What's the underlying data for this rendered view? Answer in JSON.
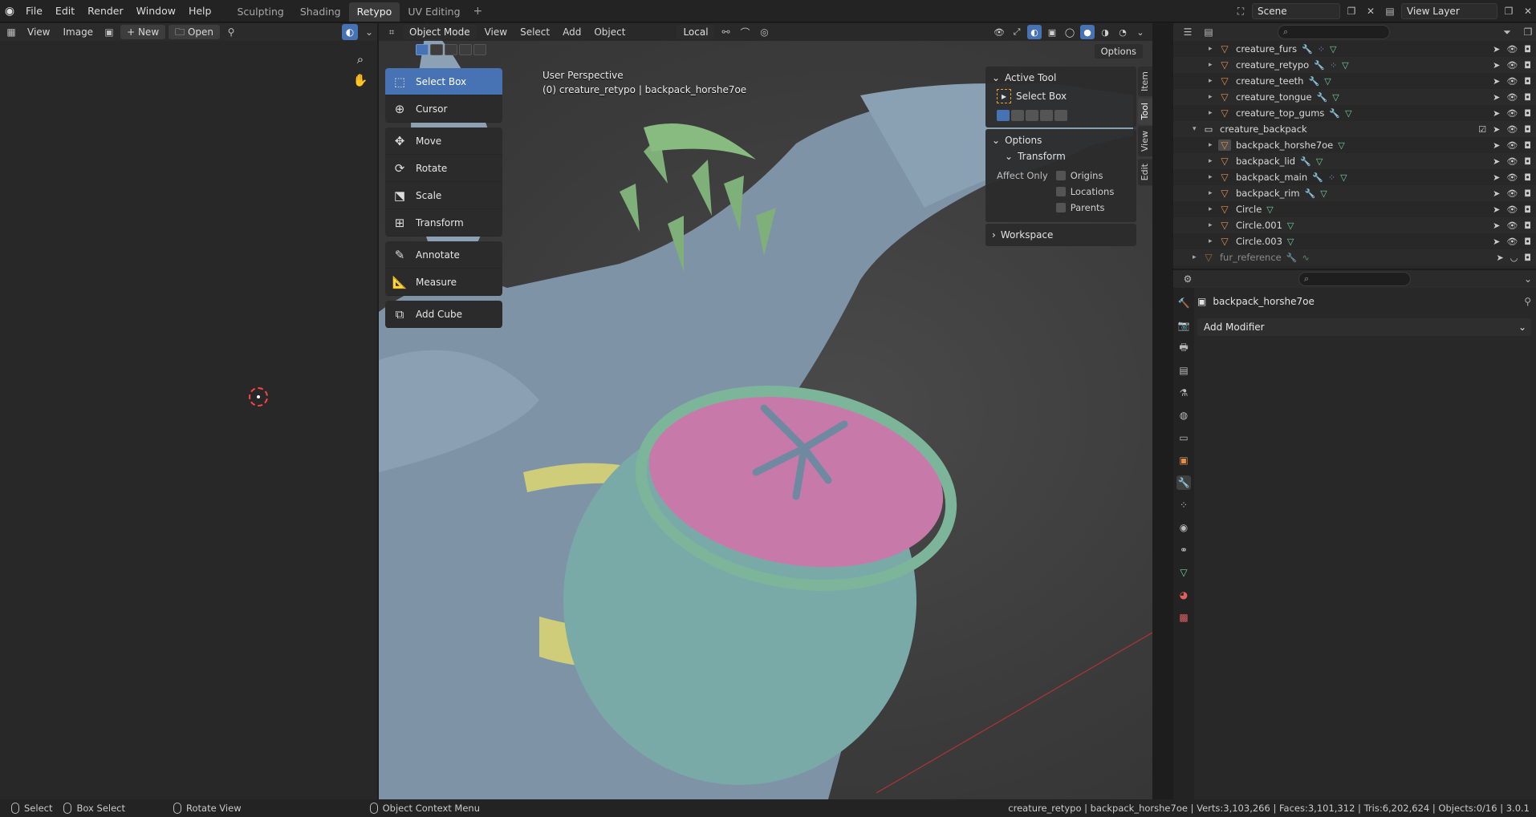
{
  "topbar": {
    "menus": [
      "File",
      "Edit",
      "Render",
      "Window",
      "Help"
    ],
    "workspace_tabs": [
      "Sculpting",
      "Shading",
      "Retypo",
      "UV Editing"
    ],
    "active_tab": "Retypo",
    "scene": "Scene",
    "view_layer": "View Layer"
  },
  "image_editor": {
    "menus": [
      "View",
      "Image"
    ],
    "new_label": "New",
    "open_label": "Open"
  },
  "viewport": {
    "mode": "Object Mode",
    "menus": [
      "View",
      "Select",
      "Add",
      "Object"
    ],
    "orientation": "Local",
    "options_label": "Options",
    "info_line1": "User Perspective",
    "info_line2": "(0) creature_retypo | backpack_horshe7oe"
  },
  "toolbar": {
    "group1": [
      "Select Box",
      "Cursor"
    ],
    "group2": [
      "Move",
      "Rotate",
      "Scale",
      "Transform"
    ],
    "group3": [
      "Annotate",
      "Measure"
    ],
    "group4": [
      "Add Cube"
    ]
  },
  "sidebar": {
    "active_tool_title": "Active Tool",
    "active_tool_name": "Select Box",
    "options_title": "Options",
    "transform_title": "Transform",
    "affect_only_label": "Affect Only",
    "checkboxes": [
      "Origins",
      "Locations",
      "Parents"
    ],
    "workspace_title": "Workspace",
    "tabs": [
      "Item",
      "Tool",
      "View",
      "Edit"
    ]
  },
  "outliner": {
    "rows": [
      {
        "name": "creature_furs"
      },
      {
        "name": "creature_retypo"
      },
      {
        "name": "creature_teeth"
      },
      {
        "name": "creature_tongue"
      },
      {
        "name": "creature_top_gums"
      },
      {
        "name": "creature_backpack"
      },
      {
        "name": "backpack_horshe7oe"
      },
      {
        "name": "backpack_lid"
      },
      {
        "name": "backpack_main"
      },
      {
        "name": "backpack_rim"
      },
      {
        "name": "Circle"
      },
      {
        "name": "Circle.001"
      },
      {
        "name": "Circle.003"
      },
      {
        "name": "fur_reference"
      }
    ]
  },
  "properties": {
    "object_name": "backpack_horshe7oe",
    "add_modifier": "Add Modifier"
  },
  "statusbar": {
    "select": "Select",
    "box_select": "Box Select",
    "rotate_view": "Rotate View",
    "context_menu": "Object Context Menu",
    "stats": "creature_retypo | backpack_horshe7oe | Verts:3,103,266 | Faces:3,101,312 | Tris:6,202,624 | Objects:0/16 | 3.0.1"
  }
}
